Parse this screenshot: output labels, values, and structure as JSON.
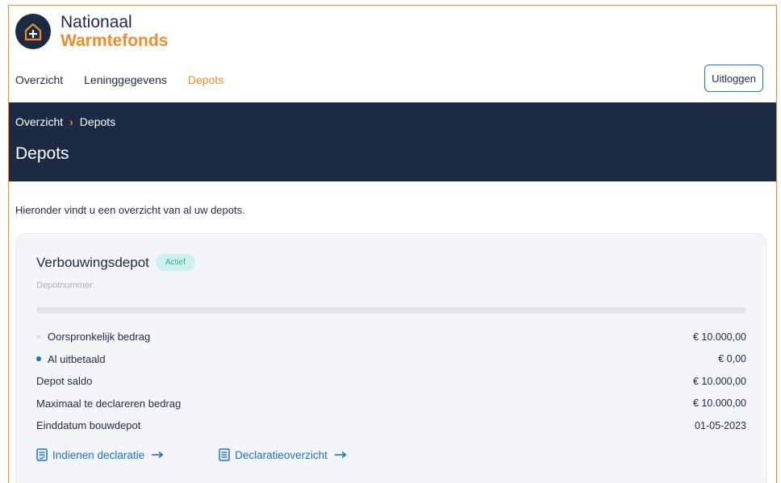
{
  "brand": {
    "name_line1": "Nationaal",
    "name_line2": "Warmtefonds"
  },
  "nav": {
    "items": [
      {
        "label": "Overzicht",
        "active": false
      },
      {
        "label": "Leninggegevens",
        "active": false
      },
      {
        "label": "Depots",
        "active": true
      }
    ],
    "logout_label": "Uitloggen"
  },
  "header": {
    "breadcrumb": [
      "Overzicht",
      "Depots"
    ],
    "breadcrumb_separator": "›",
    "title": "Depots"
  },
  "intro_text": "Hieronder vindt u een overzicht van al uw depots.",
  "depot": {
    "title": "Verbouwingsdepot",
    "status": "Actief",
    "number_label": "Depotnummer:",
    "progress_fraction": 0,
    "rows": [
      {
        "label": "Oorspronkelijk bedrag",
        "value": "€ 10.000,00",
        "dot": "#e0e3e8"
      },
      {
        "label": "Al uitbetaald",
        "value": "€ 0,00",
        "dot": "#1c6fd1"
      },
      {
        "label": "Depot saldo",
        "value": "€ 10.000,00",
        "dot": null
      },
      {
        "label": "Maximaal te declareren bedrag",
        "value": "€ 10.000,00",
        "dot": null
      },
      {
        "label": "Einddatum bouwdepot",
        "value": "01-05-2023",
        "dot": null
      }
    ],
    "actions": [
      {
        "label": "Indienen declaratie",
        "icon": "form-icon"
      },
      {
        "label": "Declaratieoverzicht",
        "icon": "document-icon"
      }
    ]
  },
  "colors": {
    "navy": "#1c2a44",
    "orange": "#f28a2a",
    "blue": "#1c6fd1",
    "badge_bg": "#cdf3f1"
  }
}
